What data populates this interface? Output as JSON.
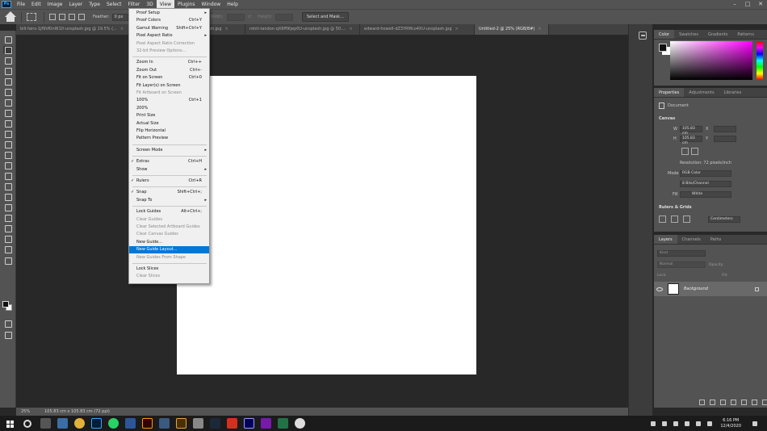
{
  "menubar": {
    "items": [
      "File",
      "Edit",
      "Image",
      "Layer",
      "Type",
      "Select",
      "Filter",
      "3D",
      "View",
      "Plugins",
      "Window",
      "Help"
    ],
    "active": "View"
  },
  "options": {
    "feather_label": "Feather:",
    "feather_value": "0 px",
    "width_label": "Width:",
    "height_label": "Height:",
    "select_mask_label": "Select and Mask..."
  },
  "tabs": [
    {
      "label": "bill-fairs-1jf9VKInW10-unsplash.jpg @ 19.5% (...",
      "active": false
    },
    {
      "label": "neil-rosenstech-Rp8M5ut_bVY-unsplash.jpg",
      "active": false
    },
    {
      "label": "rohit-tandon-qX6ff9Ijep0U-unsplash.jpg @ 50....",
      "active": false
    },
    {
      "label": "edward-howell-dZ3YRMco4XU-unsplash.jpg",
      "active": false
    },
    {
      "label": "Untitled-2 @ 25% (RGB/8#)",
      "active": true
    }
  ],
  "view_menu": {
    "items": [
      {
        "label": "Proof Setup",
        "shortcut": "",
        "submenu": true,
        "disabled": false
      },
      {
        "label": "Proof Colors",
        "shortcut": "Ctrl+Y",
        "disabled": false
      },
      {
        "label": "Gamut Warning",
        "shortcut": "Shift+Ctrl+Y",
        "disabled": false
      },
      {
        "label": "Pixel Aspect Ratio",
        "shortcut": "",
        "submenu": true,
        "disabled": false
      },
      {
        "label": "Pixel Aspect Ratio Correction",
        "shortcut": "",
        "disabled": true
      },
      {
        "label": "32-bit Preview Options...",
        "shortcut": "",
        "disabled": true
      },
      {
        "sep": true
      },
      {
        "label": "Zoom In",
        "shortcut": "Ctrl++",
        "disabled": false
      },
      {
        "label": "Zoom Out",
        "shortcut": "Ctrl+-",
        "disabled": false
      },
      {
        "label": "Fit on Screen",
        "shortcut": "Ctrl+0",
        "disabled": false
      },
      {
        "label": "Fit Layer(s) on Screen",
        "shortcut": "",
        "disabled": false
      },
      {
        "label": "Fit Artboard on Screen",
        "shortcut": "",
        "disabled": true
      },
      {
        "label": "100%",
        "shortcut": "Ctrl+1",
        "disabled": false
      },
      {
        "label": "200%",
        "shortcut": "",
        "disabled": false
      },
      {
        "label": "Print Size",
        "shortcut": "",
        "disabled": false
      },
      {
        "label": "Actual Size",
        "shortcut": "",
        "disabled": false
      },
      {
        "label": "Flip Horizontal",
        "shortcut": "",
        "disabled": false
      },
      {
        "label": "Pattern Preview",
        "shortcut": "",
        "disabled": false
      },
      {
        "sep": true
      },
      {
        "label": "Screen Mode",
        "shortcut": "",
        "submenu": true,
        "disabled": false
      },
      {
        "sep": true
      },
      {
        "label": "Extras",
        "shortcut": "Ctrl+H",
        "checked": true,
        "disabled": false
      },
      {
        "label": "Show",
        "shortcut": "",
        "submenu": true,
        "disabled": false
      },
      {
        "sep": true
      },
      {
        "label": "Rulers",
        "shortcut": "Ctrl+R",
        "checked": true,
        "disabled": false
      },
      {
        "sep": true
      },
      {
        "label": "Snap",
        "shortcut": "Shift+Ctrl+;",
        "checked": true,
        "disabled": false
      },
      {
        "label": "Snap To",
        "shortcut": "",
        "submenu": true,
        "disabled": false
      },
      {
        "sep": true
      },
      {
        "label": "Lock Guides",
        "shortcut": "Alt+Ctrl+;",
        "disabled": false
      },
      {
        "label": "Clear Guides",
        "shortcut": "",
        "disabled": true
      },
      {
        "label": "Clear Selected Artboard Guides",
        "shortcut": "",
        "disabled": true
      },
      {
        "label": "Clear Canvas Guides",
        "shortcut": "",
        "disabled": true
      },
      {
        "label": "New Guide...",
        "shortcut": "",
        "disabled": false
      },
      {
        "label": "New Guide Layout...",
        "shortcut": "",
        "disabled": false,
        "highlighted": true
      },
      {
        "label": "New Guides From Shape",
        "shortcut": "",
        "disabled": true
      },
      {
        "sep": true
      },
      {
        "label": "Lock Slices",
        "shortcut": "",
        "disabled": false
      },
      {
        "label": "Clear Slices",
        "shortcut": "",
        "disabled": true
      }
    ]
  },
  "status": {
    "zoom": "25%",
    "doc_size": "105.83 cm x 105.83 cm (72 ppi)"
  },
  "color_panel": {
    "tabs": [
      "Color",
      "Swatches",
      "Gradients",
      "Patterns"
    ],
    "active": "Color"
  },
  "properties_panel": {
    "tabs": [
      "Properties",
      "Adjustments",
      "Libraries"
    ],
    "active": "Properties",
    "type_label": "Document",
    "canvas_section": "Canvas",
    "w_label": "W",
    "w_value": "105.83 cm",
    "h_label": "H",
    "h_value": "105.83 cm",
    "x_label": "X",
    "y_label": "Y",
    "resolution": "Resolution: 72 pixels/inch",
    "mode_label": "Mode",
    "mode_value": "RGB Color",
    "depth_value": "8 Bits/Channel",
    "fill_label": "Fill",
    "fill_value": "White",
    "rulers_section": "Rulers & Grids",
    "units_value": "Centimeters"
  },
  "layers_panel": {
    "tabs": [
      "Layers",
      "Channels",
      "Paths"
    ],
    "active": "Layers",
    "search_placeholder": "Kind",
    "blend_mode": "Normal",
    "opacity_label": "Opacity:",
    "lock_label": "Lock:",
    "fill_label": "Fill:",
    "layer_name": "Background"
  },
  "taskbar": {
    "time": "6:16 PM",
    "date": "12/4/2020"
  }
}
